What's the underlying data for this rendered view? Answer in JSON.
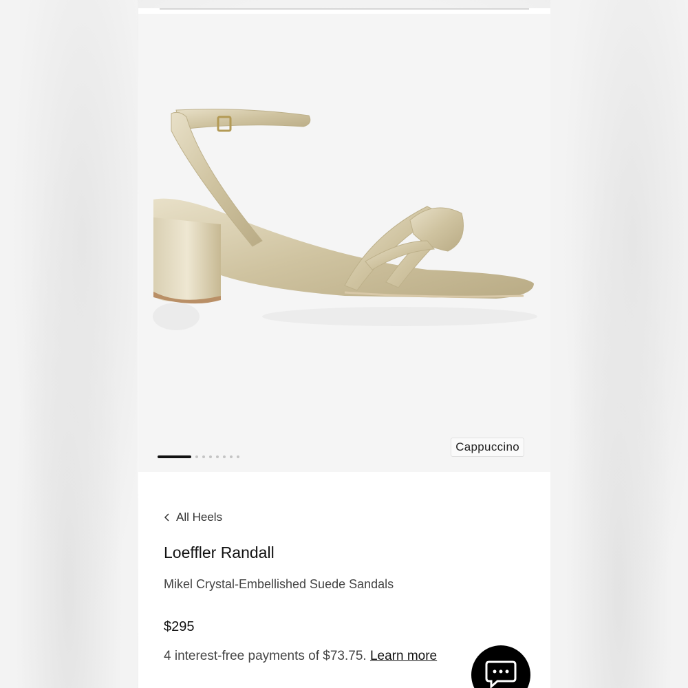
{
  "gallery": {
    "product_image": "gold crystal-embellished knotted block-heel sandal",
    "total_images": 8,
    "active_index": 0,
    "color_label": "Cappuccino"
  },
  "details": {
    "breadcrumb": {
      "label": "All Heels",
      "icon": "chevron-left-icon"
    },
    "brand": "Loeffler Randall",
    "title": "Mikel Crystal-Embellished Suede Sandals",
    "price": "$295",
    "installments_text": "4 interest-free payments of $73.75.",
    "learn_more_label": "Learn more"
  },
  "chat": {
    "icon": "chat-bubble-icon"
  },
  "colors": {
    "accent": "#000000",
    "gallery_background": "#f5f5f5",
    "text_primary": "#111111",
    "text_secondary": "#444444"
  }
}
